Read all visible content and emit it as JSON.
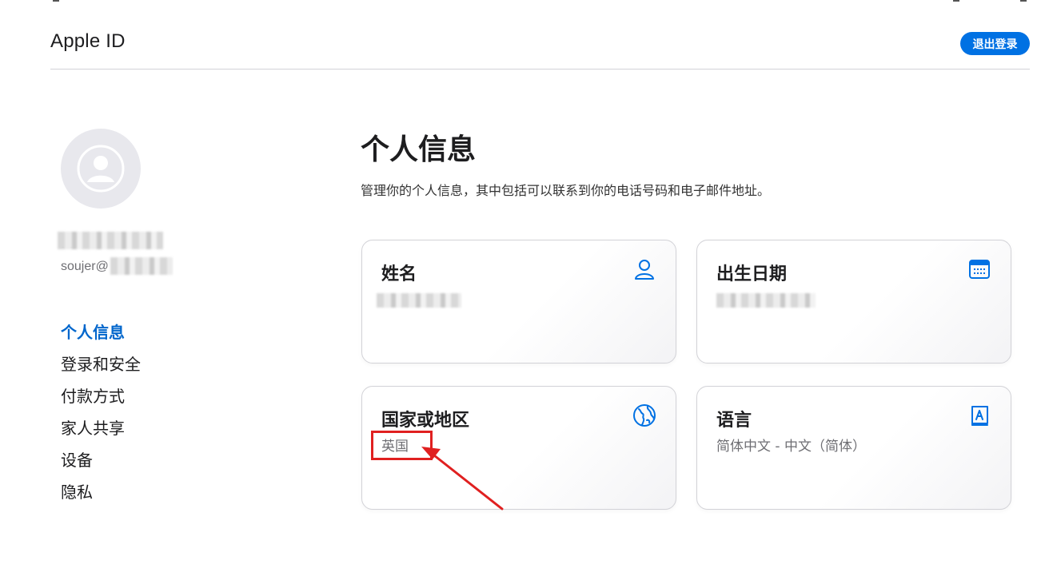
{
  "header": {
    "title": "Apple ID",
    "signout_label": "退出登录"
  },
  "user": {
    "name_visible": "M",
    "email_visible": "soujer@"
  },
  "sidenav": {
    "items": [
      {
        "label": "个人信息",
        "active": true
      },
      {
        "label": "登录和安全",
        "active": false
      },
      {
        "label": "付款方式",
        "active": false
      },
      {
        "label": "家人共享",
        "active": false
      },
      {
        "label": "设备",
        "active": false
      },
      {
        "label": "隐私",
        "active": false
      }
    ]
  },
  "main": {
    "title": "个人信息",
    "description": "管理你的个人信息，其中包括可以联系到你的电话号码和电子邮件地址。"
  },
  "cards": [
    {
      "title": "姓名",
      "value": "",
      "icon": "person-icon"
    },
    {
      "title": "出生日期",
      "value": "",
      "icon": "calendar-icon"
    },
    {
      "title": "国家或地区",
      "value": "英国",
      "icon": "globe-icon"
    },
    {
      "title": "语言",
      "value": "简体中文 - 中文（简体）",
      "icon": "language-book-icon"
    }
  ],
  "colors": {
    "accent": "#0071e3",
    "link_active": "#0066cc",
    "annotation": "#e02020"
  }
}
